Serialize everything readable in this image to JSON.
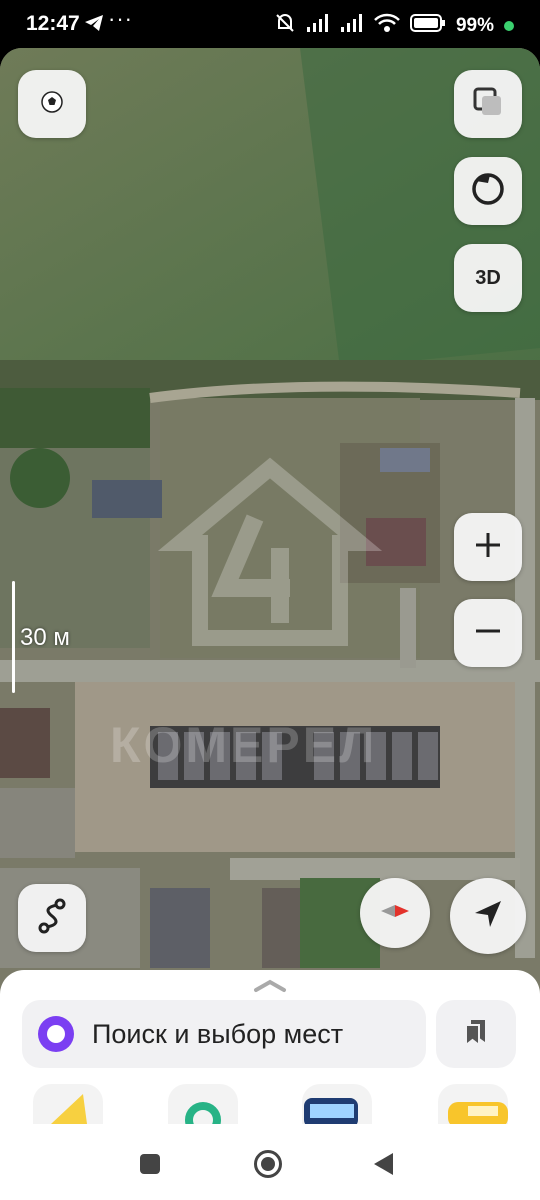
{
  "status_bar": {
    "time": "12:47",
    "more": "···",
    "battery": "99%",
    "icons": [
      "telegram-icon",
      "mute-icon",
      "signal-icon",
      "signal-icon",
      "wifi-icon",
      "battery-icon"
    ]
  },
  "map": {
    "scale_label": "30 м",
    "watermark": "КОМЕРЕЛ",
    "accent": "#7b3ff2"
  },
  "controls": {
    "layers_icon": "layers-icon",
    "sport_icon": "soccer-ball-icon",
    "loop_icon": "circle-arrow-icon",
    "mode_3d": "3D",
    "zoom_in": "+",
    "zoom_out": "−",
    "route_icon": "route-icon",
    "compass_icon": "compass-icon",
    "locate_icon": "location-arrow-icon"
  },
  "sheet": {
    "search_placeholder": "Поиск и выбор мест",
    "bookmarks_icon": "bookmarks-icon",
    "shortcuts": [
      "navigator-icon",
      "green-app-icon",
      "transport-icon",
      "taxi-icon"
    ]
  },
  "nav": {
    "recents": "square-icon",
    "home": "home-circle-icon",
    "back": "back-triangle-icon"
  }
}
